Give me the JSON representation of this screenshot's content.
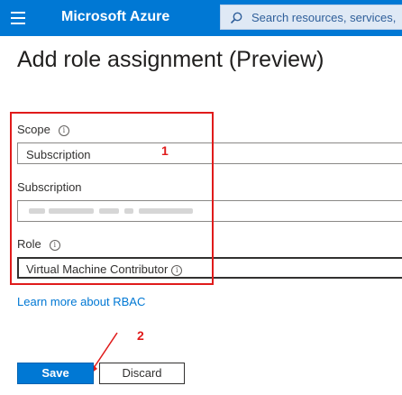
{
  "header": {
    "brand": "Microsoft Azure",
    "search_placeholder": "Search resources, services,",
    "accent": "#0078d4"
  },
  "page": {
    "title": "Add role assignment (Preview)"
  },
  "form": {
    "scope": {
      "label": "Scope",
      "value": "Subscription"
    },
    "subscription": {
      "label": "Subscription",
      "value_redacted": true
    },
    "role": {
      "label": "Role",
      "value": "Virtual Machine Contributor"
    },
    "info_icon": "ⓘ"
  },
  "annotations": {
    "box_number": "1",
    "arrow_number": "2",
    "color": "#e01b1b"
  },
  "links": {
    "rbac": "Learn more about RBAC"
  },
  "actions": {
    "save": "Save",
    "discard": "Discard"
  }
}
